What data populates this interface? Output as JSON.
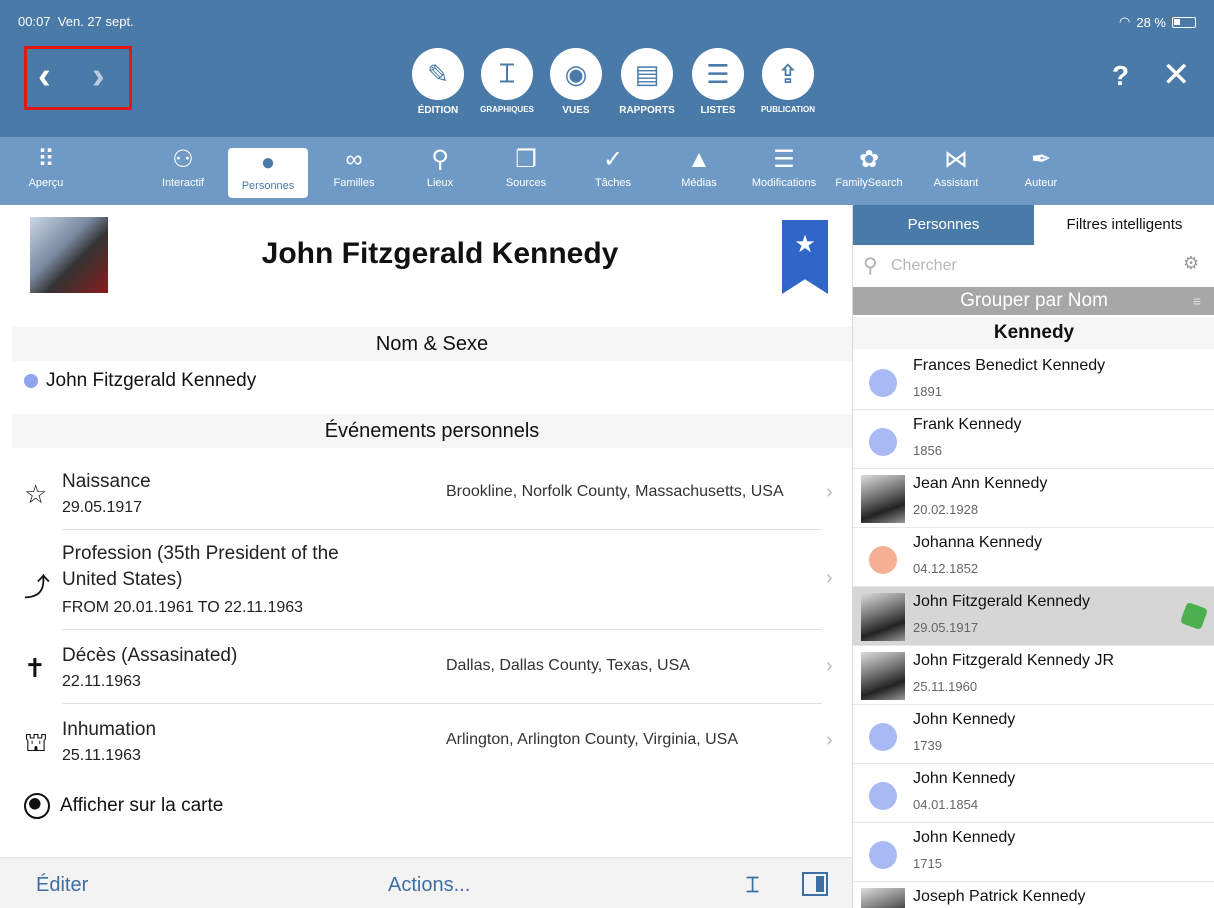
{
  "status": {
    "time": "00:07",
    "date": "Ven. 27 sept.",
    "battery": "28 %"
  },
  "nav": {
    "back": "‹",
    "forward": "›"
  },
  "modes": [
    {
      "label": "ÉDITION",
      "icon": "✎"
    },
    {
      "label": "GRAPHIQUES",
      "icon": "⌶"
    },
    {
      "label": "VUES",
      "icon": "◉"
    },
    {
      "label": "RAPPORTS",
      "icon": "▤"
    },
    {
      "label": "LISTES",
      "icon": "☰"
    },
    {
      "label": "PUBLICATION",
      "icon": "⇪"
    }
  ],
  "top_actions": {
    "help": "?",
    "close": "✕"
  },
  "funcbar": [
    {
      "label": "Aperçu",
      "icon": "⠿"
    },
    {
      "label": "Interactif",
      "icon": "⚇"
    },
    {
      "label": "Personnes",
      "icon": "●"
    },
    {
      "label": "Familles",
      "icon": "∞"
    },
    {
      "label": "Lieux",
      "icon": "⚲"
    },
    {
      "label": "Sources",
      "icon": "❐"
    },
    {
      "label": "Tâches",
      "icon": "✓"
    },
    {
      "label": "Médias",
      "icon": "▲"
    },
    {
      "label": "Modifications",
      "icon": "☰"
    },
    {
      "label": "FamilySearch",
      "icon": "✿"
    },
    {
      "label": "Assistant",
      "icon": "⋈"
    },
    {
      "label": "Auteur",
      "icon": "✒"
    }
  ],
  "person": {
    "name": "John Fitzgerald Kennedy",
    "bookmark_icon": "★",
    "section_name": "Nom & Sexe",
    "full_name": "John Fitzgerald Kennedy",
    "section_events": "Événements personnels",
    "events": [
      {
        "icon": "☆",
        "title": "Naissance",
        "date": "29.05.1917",
        "place": "Brookline, Norfolk County, Massachusetts, USA"
      },
      {
        "icon": "⤴",
        "title": "Profession (35th President of the",
        "title2": "United States)",
        "date": "FROM 20.01.1961 TO 22.11.1963",
        "place": ""
      },
      {
        "icon": "✝",
        "title": "Décès (Assasinated)",
        "date": "22.11.1963",
        "place": "Dallas, Dallas County, Texas, USA"
      },
      {
        "icon": "⛫",
        "title": "Inhumation",
        "date": "25.11.1963",
        "place": "Arlington, Arlington County, Virginia, USA"
      }
    ],
    "map_link": "Afficher sur la carte"
  },
  "bottombar": {
    "edit": "Éditer",
    "actions": "Actions..."
  },
  "sidebar": {
    "tab_persons": "Personnes",
    "tab_filters": "Filtres intelligents",
    "search_placeholder": "Chercher",
    "group_by": "Grouper par Nom",
    "group_name": "Kennedy",
    "people": [
      {
        "name": "Frances Benedict Kennedy",
        "date": "1891",
        "avatar": "#a9b9f3"
      },
      {
        "name": "Frank Kennedy",
        "date": "1856",
        "avatar": "#a9b9f3"
      },
      {
        "name": "Jean Ann Kennedy",
        "date": "20.02.1928",
        "avatar": "photo"
      },
      {
        "name": "Johanna Kennedy",
        "date": "04.12.1852",
        "avatar": "#f5b093"
      },
      {
        "name": "John Fitzgerald Kennedy",
        "date": "29.05.1917",
        "avatar": "photo"
      },
      {
        "name": "John Fitzgerald Kennedy JR",
        "date": "25.11.1960",
        "avatar": "photo"
      },
      {
        "name": "John Kennedy",
        "date": "1739",
        "avatar": "#a9b9f3"
      },
      {
        "name": "John Kennedy",
        "date": "04.01.1854",
        "avatar": "#a9b9f3"
      },
      {
        "name": "John Kennedy",
        "date": "1715",
        "avatar": "#a9b9f3"
      },
      {
        "name": "Joseph Patrick Kennedy",
        "date": "",
        "avatar": "photo"
      }
    ]
  },
  "colors": {
    "toolbar": "#4a7aa7",
    "funcbar": "#6f9ac6",
    "accent": "#3e6fa4",
    "highlight_box": "#e21818"
  }
}
